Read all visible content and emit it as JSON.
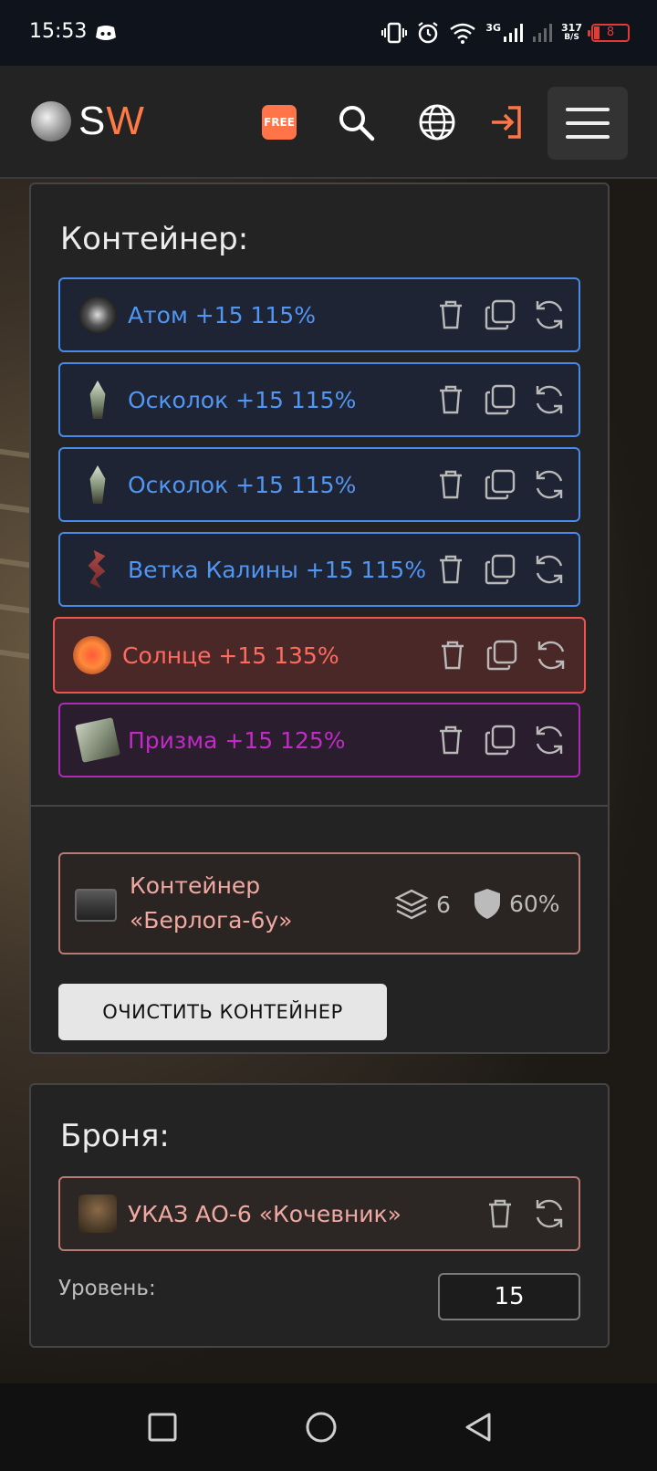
{
  "status_bar": {
    "time": "15:53",
    "network": "3G",
    "speed_value": "317",
    "speed_unit": "B/S",
    "battery": "8"
  },
  "header": {
    "logo_s": "S",
    "logo_w": "W",
    "free_badge": "FREE"
  },
  "container_panel": {
    "title": "Контейнер:",
    "items": [
      {
        "label": "Атом +15 115%",
        "tier": "blue",
        "icon": "atom-artifact-icon"
      },
      {
        "label": "Осколок +15 115%",
        "tier": "blue",
        "icon": "shard-artifact-icon"
      },
      {
        "label": "Осколок +15 115%",
        "tier": "blue",
        "icon": "shard-artifact-icon"
      },
      {
        "label": "Ветка Калины +15 115%",
        "tier": "blue",
        "icon": "viburnum-branch-icon"
      },
      {
        "label": "Солнце +15 135%",
        "tier": "red",
        "icon": "sun-artifact-icon"
      },
      {
        "label": "Призма +15 125%",
        "tier": "purple",
        "icon": "prism-artifact-icon"
      }
    ],
    "container_name_line1": "Контейнер",
    "container_name_line2": "«Берлога-6у»",
    "slots": "6",
    "protection": "60%",
    "clear_button": "ОЧИСТИТЬ КОНТЕЙНЕР"
  },
  "armor_panel": {
    "title": "Броня:",
    "armor_name": "УКАЗ АО-6 «Кочевник»",
    "level_label": "Уровень:",
    "level_value": "15"
  },
  "colors": {
    "accent": "#ff7448",
    "blue_tier": "#4a89e8",
    "red_tier": "#ef5350",
    "purple_tier": "#b02ab8",
    "container_tier": "#b77b76"
  }
}
